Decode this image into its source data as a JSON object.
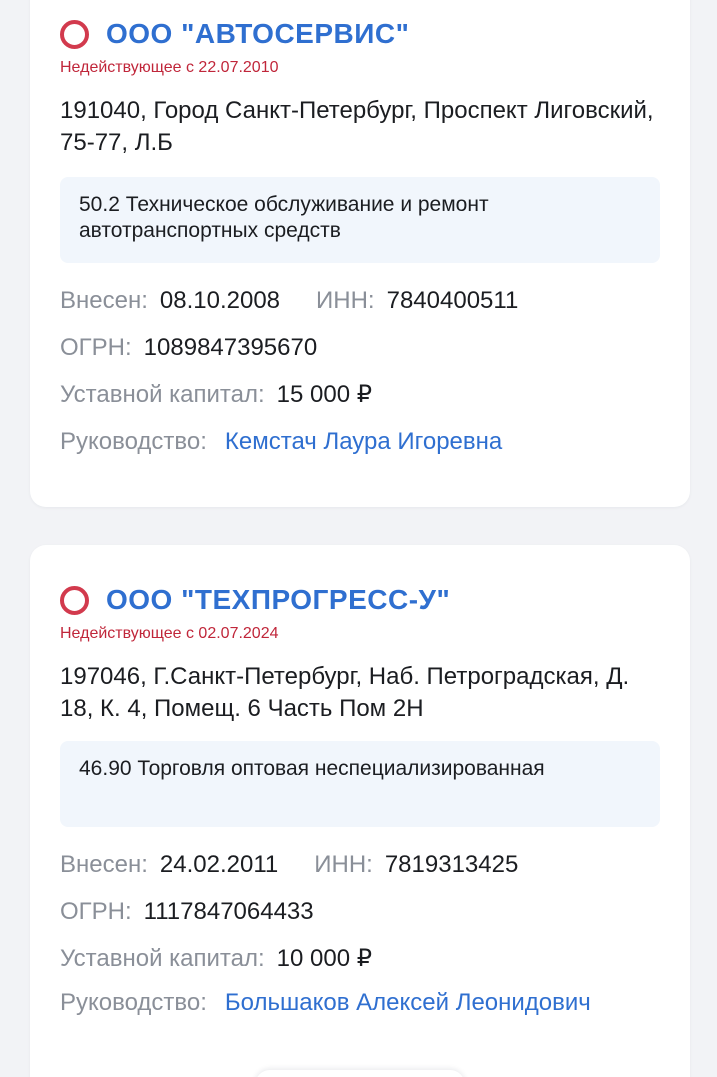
{
  "companies": [
    {
      "name": "ООО \"АВТОСЕРВИС\"",
      "status": "Недействующее с 22.07.2010",
      "address": "191040, Город Санкт-Петербург, Проспект Лиговский, 75-77, Л.Б",
      "okved": "50.2 Техническое обслуживание и ремонт автотранспортных средств",
      "registered_label": "Внесен:",
      "registered": "08.10.2008",
      "inn_label": "ИНН:",
      "inn": "7840400511",
      "ogrn_label": "ОГРН:",
      "ogrn": "1089847395670",
      "capital_label": "Уставной капитал:",
      "capital": "15 000 ₽",
      "manager_label": "Руководство:",
      "manager": "Кемстач Лаура Игоревна"
    },
    {
      "name": "ООО \"ТЕХПРОГРЕСС-У\"",
      "status": "Недействующее с 02.07.2024",
      "address": "197046, Г.Санкт-Петербург, Наб. Петроградская, Д. 18, К. 4, Помещ. 6 Часть Пом 2Н",
      "okved": "46.90 Торговля оптовая неспециализированная",
      "registered_label": "Внесен:",
      "registered": "24.02.2011",
      "inn_label": "ИНН:",
      "inn": "7819313425",
      "ogrn_label": "ОГРН:",
      "ogrn": "1117847064433",
      "capital_label": "Уставной капитал:",
      "capital": "10 000 ₽",
      "manager_label": "Руководство:",
      "manager": "Большаков Алексей Леонидович"
    }
  ],
  "colors": {
    "link": "#2f6fd0",
    "inactive": "#c0263a",
    "label": "#8a8f98",
    "okved_bg": "#f1f6fc"
  }
}
